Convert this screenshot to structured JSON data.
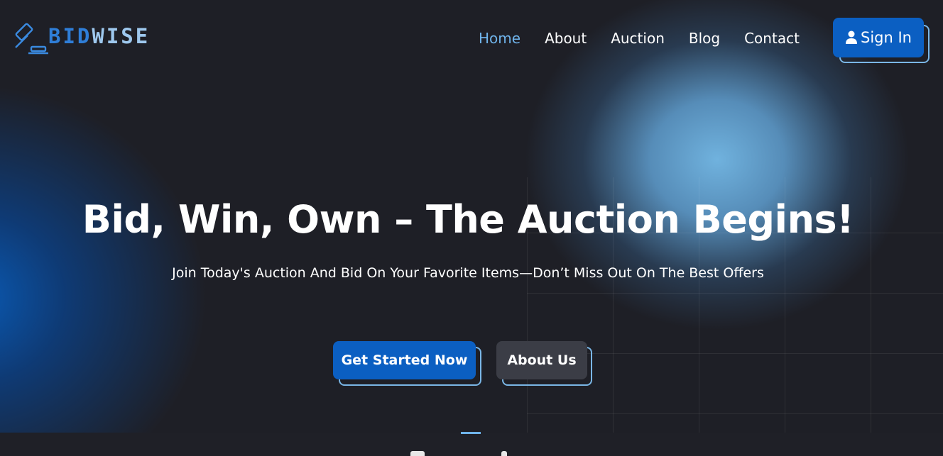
{
  "brand": {
    "name_part1": "BID",
    "name_part2": "WISE",
    "primary_color": "#2f7ed8",
    "light_color": "#9ec8ee",
    "logo_icon": "gavel-icon"
  },
  "nav": {
    "items": [
      {
        "label": "Home",
        "active": true
      },
      {
        "label": "About",
        "active": false
      },
      {
        "label": "Auction",
        "active": false
      },
      {
        "label": "Blog",
        "active": false
      },
      {
        "label": "Contact",
        "active": false
      }
    ],
    "signin_label": "Sign In",
    "signin_icon": "user-icon"
  },
  "hero": {
    "headline": "Bid, Win, Own – The Auction Begins!",
    "subheadline": "Join Today's Auction And Bid On Your Favorite Items—Don’t Miss Out On The Best Offers",
    "primary_button": "Get Started Now",
    "secondary_button": "About Us"
  },
  "colors": {
    "accent": "#0b5fc2",
    "active_link": "#6fb3ea",
    "background": "#1e1f26",
    "button_dark": "#3b3d46"
  }
}
